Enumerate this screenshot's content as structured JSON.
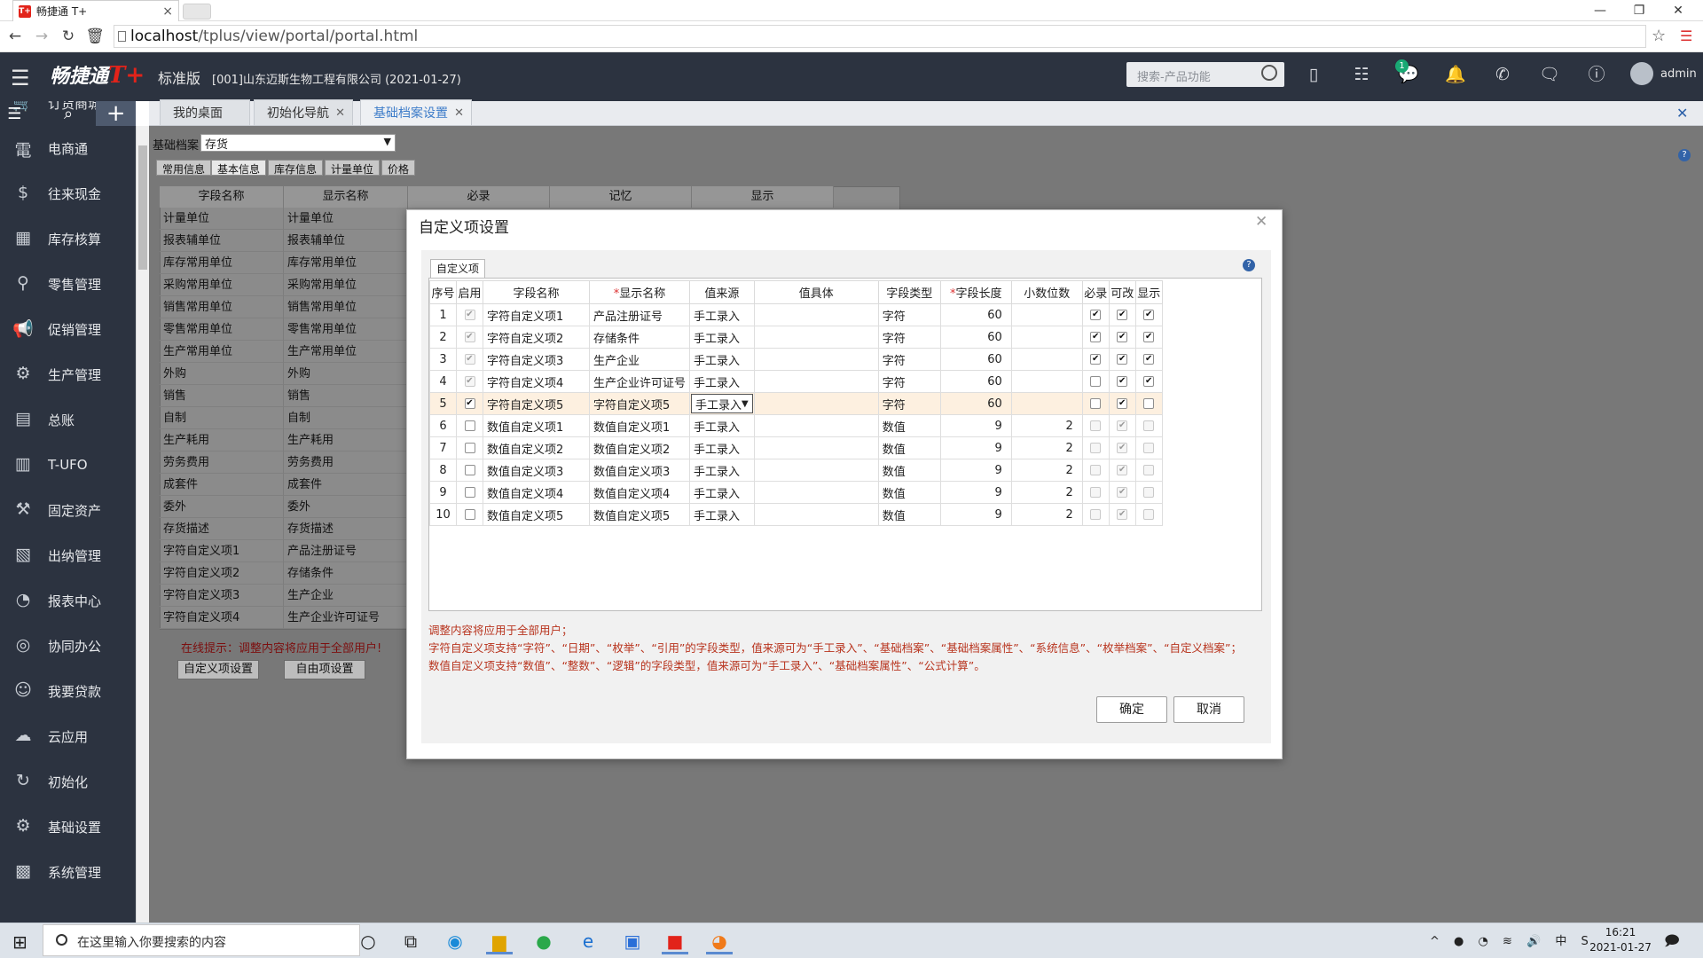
{
  "browser": {
    "tab_title": "畅捷通 T+",
    "favicon": "T+",
    "url_host": "localhost",
    "url_path": "/tplus/view/portal/portal.html"
  },
  "app": {
    "brand": "畅捷通",
    "brand_tplus": "T+",
    "edition": "标准版",
    "company": "[001]山东迈斯生物工程有限公司 (2021-01-27)",
    "search_placeholder": "搜索-产品功能",
    "message_badge": "1",
    "user": "admin"
  },
  "sidebar": {
    "items": [
      {
        "label": "订货商城",
        "icon": "cart-icon"
      },
      {
        "label": "电商通",
        "icon": "ecommerce-icon"
      },
      {
        "label": "往来现金",
        "icon": "cash-icon"
      },
      {
        "label": "库存核算",
        "icon": "inventory-icon"
      },
      {
        "label": "零售管理",
        "icon": "retail-icon"
      },
      {
        "label": "促销管理",
        "icon": "megaphone-icon"
      },
      {
        "label": "生产管理",
        "icon": "gears-icon"
      },
      {
        "label": "总账",
        "icon": "ledger-icon"
      },
      {
        "label": "T-UFO",
        "icon": "report-icon"
      },
      {
        "label": "固定资产",
        "icon": "asset-icon"
      },
      {
        "label": "出纳管理",
        "icon": "cashier-icon"
      },
      {
        "label": "报表中心",
        "icon": "pie-chart-icon"
      },
      {
        "label": "协同办公",
        "icon": "collab-icon"
      },
      {
        "label": "我要贷款",
        "icon": "loan-icon"
      },
      {
        "label": "云应用",
        "icon": "cloud-icon"
      },
      {
        "label": "初始化",
        "icon": "init-icon"
      },
      {
        "label": "基础设置",
        "icon": "settings-icon"
      },
      {
        "label": "系统管理",
        "icon": "system-icon"
      }
    ]
  },
  "main_tabs": [
    {
      "label": "我的桌面"
    },
    {
      "label": "初始化导航"
    },
    {
      "label": "基础档案设置"
    }
  ],
  "bg": {
    "archive_label": "基础档案",
    "archive_value": "存货",
    "tabs": [
      "常用信息",
      "基本信息",
      "库存信息",
      "计量单位",
      "价格"
    ],
    "headers": [
      "字段名称",
      "显示名称",
      "必录",
      "记忆",
      "显示"
    ],
    "rows": [
      [
        "计量单位",
        "计量单位"
      ],
      [
        "报表辅单位",
        "报表辅单位"
      ],
      [
        "库存常用单位",
        "库存常用单位"
      ],
      [
        "采购常用单位",
        "采购常用单位"
      ],
      [
        "销售常用单位",
        "销售常用单位"
      ],
      [
        "零售常用单位",
        "零售常用单位"
      ],
      [
        "生产常用单位",
        "生产常用单位"
      ],
      [
        "外购",
        "外购"
      ],
      [
        "销售",
        "销售"
      ],
      [
        "自制",
        "自制"
      ],
      [
        "生产耗用",
        "生产耗用"
      ],
      [
        "劳务费用",
        "劳务费用"
      ],
      [
        "成套件",
        "成套件"
      ],
      [
        "委外",
        "委外"
      ],
      [
        "存货描述",
        "存货描述"
      ],
      [
        "字符自定义项1",
        "产品注册证号"
      ],
      [
        "字符自定义项2",
        "存储条件"
      ],
      [
        "字符自定义项3",
        "生产企业"
      ],
      [
        "字符自定义项4",
        "生产企业许可证号"
      ]
    ],
    "hint": "在线提示：调整内容将应用于全部用户!",
    "btn_custom": "自定义项设置",
    "btn_free": "自由项设置"
  },
  "dialog": {
    "title": "自定义项设置",
    "inner_tab": "自定义项",
    "columns": [
      "序号",
      "启用",
      "字段名称",
      "显示名称",
      "值来源",
      "值具体",
      "字段类型",
      "字段长度",
      "小数位数",
      "必录",
      "可改",
      "显示"
    ],
    "rows": [
      {
        "no": "1",
        "enabled": true,
        "enabled_dis": true,
        "field": "字符自定义项1",
        "display": "产品注册证号",
        "source": "手工录入",
        "detail": "",
        "type": "字符",
        "length": "60",
        "decimals": "",
        "required": true,
        "editable": true,
        "show": true,
        "dis": false
      },
      {
        "no": "2",
        "enabled": true,
        "enabled_dis": true,
        "field": "字符自定义项2",
        "display": "存储条件",
        "source": "手工录入",
        "detail": "",
        "type": "字符",
        "length": "60",
        "decimals": "",
        "required": true,
        "editable": true,
        "show": true,
        "dis": false
      },
      {
        "no": "3",
        "enabled": true,
        "enabled_dis": true,
        "field": "字符自定义项3",
        "display": "生产企业",
        "source": "手工录入",
        "detail": "",
        "type": "字符",
        "length": "60",
        "decimals": "",
        "required": true,
        "editable": true,
        "show": true,
        "dis": false
      },
      {
        "no": "4",
        "enabled": true,
        "enabled_dis": true,
        "field": "字符自定义项4",
        "display": "生产企业许可证号",
        "source": "手工录入",
        "detail": "",
        "type": "字符",
        "length": "60",
        "decimals": "",
        "required": false,
        "editable": true,
        "show": true,
        "dis": false
      },
      {
        "no": "5",
        "enabled": true,
        "enabled_dis": false,
        "field": "字符自定义项5",
        "display": "字符自定义项5",
        "source": "手工录入",
        "detail": "",
        "type": "字符",
        "length": "60",
        "decimals": "",
        "required": false,
        "editable": true,
        "show": false,
        "dis": false,
        "selected": true
      },
      {
        "no": "6",
        "enabled": false,
        "enabled_dis": false,
        "field": "数值自定义项1",
        "display": "数值自定义项1",
        "source": "手工录入",
        "detail": "",
        "type": "数值",
        "length": "9",
        "decimals": "2",
        "required": false,
        "editable": true,
        "show": false,
        "dis": true
      },
      {
        "no": "7",
        "enabled": false,
        "enabled_dis": false,
        "field": "数值自定义项2",
        "display": "数值自定义项2",
        "source": "手工录入",
        "detail": "",
        "type": "数值",
        "length": "9",
        "decimals": "2",
        "required": false,
        "editable": true,
        "show": false,
        "dis": true
      },
      {
        "no": "8",
        "enabled": false,
        "enabled_dis": false,
        "field": "数值自定义项3",
        "display": "数值自定义项3",
        "source": "手工录入",
        "detail": "",
        "type": "数值",
        "length": "9",
        "decimals": "2",
        "required": false,
        "editable": true,
        "show": false,
        "dis": true
      },
      {
        "no": "9",
        "enabled": false,
        "enabled_dis": false,
        "field": "数值自定义项4",
        "display": "数值自定义项4",
        "source": "手工录入",
        "detail": "",
        "type": "数值",
        "length": "9",
        "decimals": "2",
        "required": false,
        "editable": true,
        "show": false,
        "dis": true
      },
      {
        "no": "10",
        "enabled": false,
        "enabled_dis": false,
        "field": "数值自定义项5",
        "display": "数值自定义项5",
        "source": "手工录入",
        "detail": "",
        "type": "数值",
        "length": "9",
        "decimals": "2",
        "required": false,
        "editable": true,
        "show": false,
        "dis": true
      }
    ],
    "notes": [
      "调整内容将应用于全部用户；",
      "字符自定义项支持“字符”、“日期”、“枚举”、“引用”的字段类型，值来源可为“手工录入”、“基础档案”、“基础档案属性”、“系统信息”、“枚举档案”、“自定义档案”；",
      "数值自定义项支持“数值”、“整数”、“逻辑”的字段类型，值来源可为“手工录入”、“基础档案属性”、“公式计算”。"
    ],
    "ok": "确定",
    "cancel": "取消"
  },
  "taskbar": {
    "search_placeholder": "在这里输入你要搜索的内容",
    "time": "16:21",
    "date": "2021-01-27"
  }
}
